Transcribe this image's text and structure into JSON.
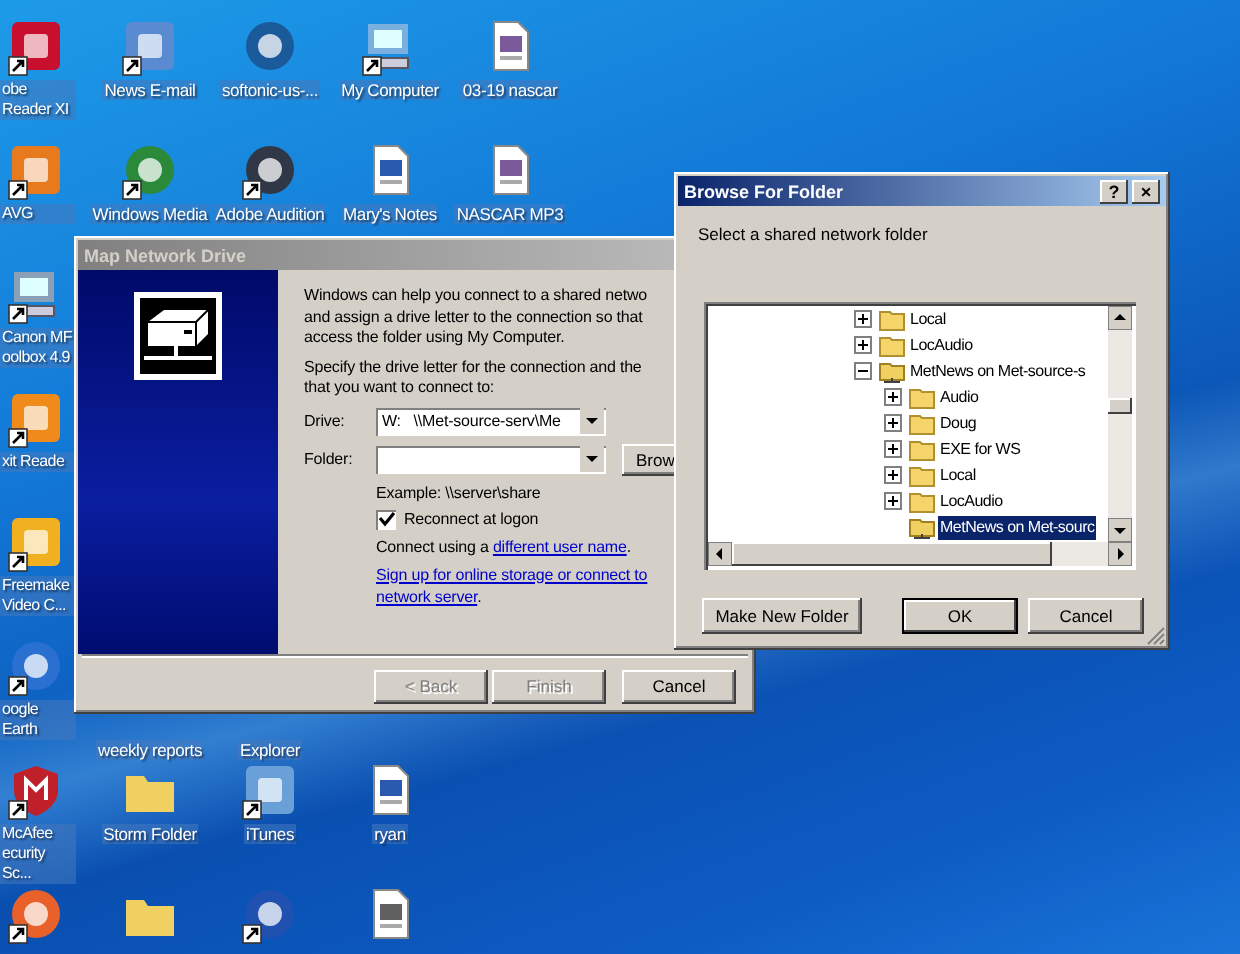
{
  "desktop": {
    "columns": [
      [
        {
          "label": "obe Reader XI",
          "kind": "square",
          "color": "#c8102e",
          "shortcut": true
        },
        {
          "label": "AVG",
          "kind": "square",
          "color": "#e87a1e",
          "shortcut": true
        },
        {
          "label": "Canon MF oolbox 4.9",
          "kind": "computer",
          "color": "#8aa0b8",
          "shortcut": true
        },
        {
          "label": "xit Reade",
          "kind": "square",
          "color": "#f08a1a",
          "shortcut": true
        },
        {
          "label": "Freemake Video C...",
          "kind": "square",
          "color": "#f0b020",
          "shortcut": true
        },
        {
          "label": "oogle Earth",
          "kind": "circle",
          "color": "#2a70d0",
          "shortcut": true
        },
        {
          "label": "McAfee ecurity Sc...",
          "kind": "shield",
          "color": "#c0202a",
          "shortcut": true
        },
        {
          "kind": "circle",
          "color": "#e8602a",
          "shortcut": true
        }
      ],
      [
        {
          "label": "News E-mail",
          "kind": "square",
          "color": "#5a8ad0",
          "shortcut": true
        },
        {
          "label": "Windows Media",
          "kind": "circle",
          "color": "#2a8a3a",
          "shortcut": true
        },
        null,
        null,
        null,
        {
          "label": "weekly reports",
          "kind": "caption"
        },
        {
          "label": "Storm Folder",
          "kind": "folder",
          "color": "#f0d060",
          "shortcut": false
        },
        {
          "kind": "folder",
          "color": "#f0d060",
          "shortcut": false
        }
      ],
      [
        {
          "label": "softonic-us-...",
          "kind": "circle",
          "color": "#1a5a9a",
          "shortcut": false
        },
        {
          "label": "Adobe Audition",
          "kind": "circle",
          "color": "#303848",
          "shortcut": true
        },
        null,
        null,
        null,
        {
          "label": "Explorer",
          "kind": "caption"
        },
        {
          "label": "iTunes",
          "kind": "square",
          "color": "#6aa0d8",
          "shortcut": true
        },
        {
          "kind": "circle",
          "color": "#2050b0",
          "shortcut": true
        }
      ],
      [
        {
          "label": "My Computer",
          "kind": "computer",
          "color": "#7ab0e0",
          "shortcut": true
        },
        {
          "label": "Mary's Notes",
          "kind": "document",
          "color": "#2a5ab0",
          "shortcut": false
        },
        null,
        null,
        null,
        null,
        {
          "label": "ryan",
          "kind": "document",
          "color": "#2a5ab0",
          "shortcut": false
        },
        {
          "kind": "document",
          "color": "#606060",
          "shortcut": false
        }
      ],
      [
        {
          "label": "03-19 nascar",
          "kind": "document",
          "color": "#7a5a9a",
          "shortcut": false
        },
        {
          "label": "NASCAR MP3",
          "kind": "document",
          "color": "#7a5a9a",
          "shortcut": false
        }
      ]
    ]
  },
  "map_drive": {
    "title": "Map Network Drive",
    "intro": [
      "Windows can help you connect to a shared netwo",
      "and assign a drive letter to the connection so that",
      "access the folder using My Computer."
    ],
    "specify": [
      "Specify the drive letter for the connection and the",
      "that you want to connect to:"
    ],
    "drive_label": "Drive:",
    "drive_value": "W:   \\\\Met-source-serv\\Me",
    "folder_label": "Folder:",
    "browse_button": "Brow",
    "example": "Example: \\\\server\\share",
    "reconnect": {
      "label": "Reconnect at logon",
      "checked": true
    },
    "connect_prefix": "Connect using a ",
    "connect_link": "different user name",
    "connect_suffix": ".",
    "signup_link": [
      "Sign up for online storage or connect to",
      "network server"
    ],
    "signup_suffix": ".",
    "buttons": [
      {
        "label": "< Back",
        "disabled": true
      },
      {
        "label": "Finish",
        "disabled": true
      },
      {
        "label": "Cancel",
        "disabled": false
      }
    ]
  },
  "browse": {
    "title": "Browse For Folder",
    "help_button": "?",
    "close_button": "×",
    "instruction": "Select a shared network folder",
    "tree": [
      {
        "label": "Local",
        "kind": "folder",
        "has_children": true,
        "expanded": false,
        "selected": false
      },
      {
        "label": "LocAudio",
        "kind": "folder",
        "has_children": true,
        "expanded": false,
        "selected": false
      },
      {
        "label": "MetNews on Met-source-s",
        "kind": "share",
        "has_children": true,
        "expanded": true,
        "selected": false,
        "children": [
          {
            "label": "Audio",
            "kind": "folder",
            "has_children": true,
            "expanded": false,
            "selected": false
          },
          {
            "label": "Doug",
            "kind": "folder",
            "has_children": true,
            "expanded": false,
            "selected": false
          },
          {
            "label": "EXE for WS",
            "kind": "folder",
            "has_children": true,
            "expanded": false,
            "selected": false
          },
          {
            "label": "Local",
            "kind": "folder",
            "has_children": true,
            "expanded": false,
            "selected": false
          },
          {
            "label": "LocAudio",
            "kind": "folder",
            "has_children": true,
            "expanded": false,
            "selected": false
          },
          {
            "label": "MetNews on Met-sourc",
            "kind": "share",
            "has_children": false,
            "selected": true
          }
        ]
      }
    ],
    "buttons": [
      {
        "label": "Make New Folder",
        "default": false
      },
      {
        "label": "OK",
        "default": true
      },
      {
        "label": "Cancel",
        "default": false
      }
    ]
  }
}
